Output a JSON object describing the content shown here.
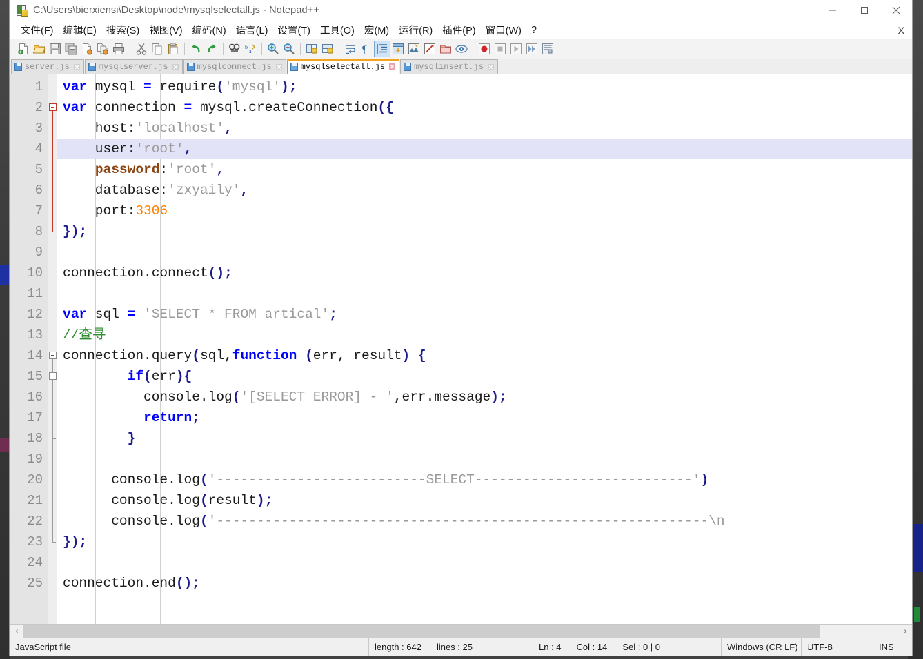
{
  "window": {
    "title": "C:\\Users\\bierxiensi\\Desktop\\node\\mysqlselectall.js - Notepad++",
    "app_icon": "notepad-plus-plus-icon",
    "controls": {
      "minimize": "–",
      "maximize": "□",
      "close": "✕"
    }
  },
  "menubar": {
    "items": [
      {
        "label": "文件(F)",
        "name": "menu-file"
      },
      {
        "label": "编辑(E)",
        "name": "menu-edit"
      },
      {
        "label": "搜索(S)",
        "name": "menu-search"
      },
      {
        "label": "视图(V)",
        "name": "menu-view"
      },
      {
        "label": "编码(N)",
        "name": "menu-encoding"
      },
      {
        "label": "语言(L)",
        "name": "menu-language"
      },
      {
        "label": "设置(T)",
        "name": "menu-settings"
      },
      {
        "label": "工具(O)",
        "name": "menu-tools"
      },
      {
        "label": "宏(M)",
        "name": "menu-macro"
      },
      {
        "label": "运行(R)",
        "name": "menu-run"
      },
      {
        "label": "插件(P)",
        "name": "menu-plugins"
      },
      {
        "label": "窗口(W)",
        "name": "menu-window"
      },
      {
        "label": "?",
        "name": "menu-help"
      }
    ],
    "close_document": "X"
  },
  "toolbar": {
    "buttons": [
      {
        "name": "new-file-icon",
        "group": 1,
        "active": false
      },
      {
        "name": "open-file-icon",
        "group": 1,
        "active": false
      },
      {
        "name": "save-icon",
        "group": 1,
        "active": false
      },
      {
        "name": "save-all-icon",
        "group": 1,
        "active": false
      },
      {
        "name": "close-file-icon",
        "group": 1,
        "active": false
      },
      {
        "name": "close-all-icon",
        "group": 1,
        "active": false
      },
      {
        "name": "print-icon",
        "group": 1,
        "active": false
      },
      {
        "name": "cut-icon",
        "group": 2,
        "active": false
      },
      {
        "name": "copy-icon",
        "group": 2,
        "active": false
      },
      {
        "name": "paste-icon",
        "group": 2,
        "active": false
      },
      {
        "name": "undo-icon",
        "group": 3,
        "active": false
      },
      {
        "name": "redo-icon",
        "group": 3,
        "active": false
      },
      {
        "name": "find-icon",
        "group": 4,
        "active": false
      },
      {
        "name": "replace-icon",
        "group": 4,
        "active": false
      },
      {
        "name": "zoom-in-icon",
        "group": 5,
        "active": false
      },
      {
        "name": "zoom-out-icon",
        "group": 5,
        "active": false
      },
      {
        "name": "sync-vertical-scroll-icon",
        "group": 6,
        "active": false
      },
      {
        "name": "sync-horizontal-scroll-icon",
        "group": 6,
        "active": false
      },
      {
        "name": "word-wrap-icon",
        "group": 7,
        "active": false
      },
      {
        "name": "show-all-chars-icon",
        "group": 7,
        "active": false
      },
      {
        "name": "indent-guide-icon",
        "group": 7,
        "active": true
      },
      {
        "name": "user-defined-dialog-icon",
        "group": 7,
        "active": false
      },
      {
        "name": "document-map-icon",
        "group": 7,
        "active": false
      },
      {
        "name": "function-list-icon",
        "group": 7,
        "active": false
      },
      {
        "name": "folder-as-workspace-icon",
        "group": 7,
        "active": false
      },
      {
        "name": "monitoring-icon",
        "group": 7,
        "active": false
      },
      {
        "name": "macro-record-icon",
        "group": 8,
        "active": false
      },
      {
        "name": "macro-stop-icon",
        "group": 8,
        "active": false
      },
      {
        "name": "macro-play-icon",
        "group": 8,
        "active": false
      },
      {
        "name": "macro-run-multiple-icon",
        "group": 8,
        "active": false
      },
      {
        "name": "macro-save-icon",
        "group": 8,
        "active": false
      }
    ]
  },
  "tabs": [
    {
      "label": "server.js",
      "active": false
    },
    {
      "label": "mysqlserver.js",
      "active": false
    },
    {
      "label": "mysqlconnect.js",
      "active": false
    },
    {
      "label": "mysqlselectall.js",
      "active": true
    },
    {
      "label": "mysqlinsert.js",
      "active": false
    }
  ],
  "editor": {
    "current_line": 4,
    "total_lines": 25,
    "line_numbers": [
      1,
      2,
      3,
      4,
      5,
      6,
      7,
      8,
      9,
      10,
      11,
      12,
      13,
      14,
      15,
      16,
      17,
      18,
      19,
      20,
      21,
      22,
      23,
      24,
      25
    ],
    "lines": [
      {
        "n": 1,
        "tokens": [
          {
            "t": "var",
            "c": "k"
          },
          {
            "t": " mysql ",
            "c": "id"
          },
          {
            "t": "=",
            "c": "op"
          },
          {
            "t": " require",
            "c": "id"
          },
          {
            "t": "(",
            "c": "p"
          },
          {
            "t": "'mysql'",
            "c": "s"
          },
          {
            "t": ")",
            "c": "p"
          },
          {
            "t": ";",
            "c": "p"
          }
        ]
      },
      {
        "n": 2,
        "tokens": [
          {
            "t": "var",
            "c": "k"
          },
          {
            "t": " connection ",
            "c": "id"
          },
          {
            "t": "=",
            "c": "op"
          },
          {
            "t": " mysql.createConnection",
            "c": "id"
          },
          {
            "t": "({",
            "c": "p"
          }
        ]
      },
      {
        "n": 3,
        "tokens": [
          {
            "t": "    host:",
            "c": "id"
          },
          {
            "t": "'localhost'",
            "c": "s"
          },
          {
            "t": ",",
            "c": "p"
          }
        ]
      },
      {
        "n": 4,
        "tokens": [
          {
            "t": "    user:",
            "c": "id"
          },
          {
            "t": "'root'",
            "c": "s"
          },
          {
            "t": ",",
            "c": "p"
          }
        ]
      },
      {
        "n": 5,
        "tokens": [
          {
            "t": "    ",
            "c": "id"
          },
          {
            "t": "password",
            "c": "kw2"
          },
          {
            "t": ":",
            "c": "id"
          },
          {
            "t": "'root'",
            "c": "s"
          },
          {
            "t": ",",
            "c": "p"
          }
        ]
      },
      {
        "n": 6,
        "tokens": [
          {
            "t": "    database:",
            "c": "id"
          },
          {
            "t": "'zxyaily'",
            "c": "s"
          },
          {
            "t": ",",
            "c": "p"
          }
        ]
      },
      {
        "n": 7,
        "tokens": [
          {
            "t": "    port:",
            "c": "id"
          },
          {
            "t": "3306",
            "c": "n"
          }
        ]
      },
      {
        "n": 8,
        "tokens": [
          {
            "t": "});",
            "c": "p"
          }
        ]
      },
      {
        "n": 9,
        "tokens": []
      },
      {
        "n": 10,
        "tokens": [
          {
            "t": "connection.connect",
            "c": "id"
          },
          {
            "t": "()",
            "c": "p"
          },
          {
            "t": ";",
            "c": "p"
          }
        ]
      },
      {
        "n": 11,
        "tokens": []
      },
      {
        "n": 12,
        "tokens": [
          {
            "t": "var",
            "c": "k"
          },
          {
            "t": " sql ",
            "c": "id"
          },
          {
            "t": "=",
            "c": "op"
          },
          {
            "t": " ",
            "c": "id"
          },
          {
            "t": "'SELECT * FROM artical'",
            "c": "s"
          },
          {
            "t": ";",
            "c": "p"
          }
        ]
      },
      {
        "n": 13,
        "tokens": [
          {
            "t": "//查寻",
            "c": "c"
          }
        ]
      },
      {
        "n": 14,
        "tokens": [
          {
            "t": "connection.query",
            "c": "id"
          },
          {
            "t": "(",
            "c": "p"
          },
          {
            "t": "sql,",
            "c": "id"
          },
          {
            "t": "function",
            "c": "k"
          },
          {
            "t": " ",
            "c": "id"
          },
          {
            "t": "(",
            "c": "p"
          },
          {
            "t": "err, result",
            "c": "id"
          },
          {
            "t": ")",
            "c": "p"
          },
          {
            "t": " ",
            "c": "id"
          },
          {
            "t": "{",
            "c": "p"
          }
        ]
      },
      {
        "n": 15,
        "tokens": [
          {
            "t": "        ",
            "c": "id"
          },
          {
            "t": "if",
            "c": "k"
          },
          {
            "t": "(",
            "c": "p"
          },
          {
            "t": "err",
            "c": "id"
          },
          {
            "t": "){",
            "c": "p"
          }
        ]
      },
      {
        "n": 16,
        "tokens": [
          {
            "t": "          console.log",
            "c": "id"
          },
          {
            "t": "(",
            "c": "p"
          },
          {
            "t": "'[SELECT ERROR] - '",
            "c": "s"
          },
          {
            "t": ",err.message",
            "c": "id"
          },
          {
            "t": ")",
            "c": "p"
          },
          {
            "t": ";",
            "c": "p"
          }
        ]
      },
      {
        "n": 17,
        "tokens": [
          {
            "t": "          ",
            "c": "id"
          },
          {
            "t": "return",
            "c": "k"
          },
          {
            "t": ";",
            "c": "p"
          }
        ]
      },
      {
        "n": 18,
        "tokens": [
          {
            "t": "        ",
            "c": "id"
          },
          {
            "t": "}",
            "c": "p"
          }
        ]
      },
      {
        "n": 19,
        "tokens": []
      },
      {
        "n": 20,
        "tokens": [
          {
            "t": "      console.log",
            "c": "id"
          },
          {
            "t": "(",
            "c": "p"
          },
          {
            "t": "'--------------------------SELECT---------------------------'",
            "c": "s"
          },
          {
            "t": ")",
            "c": "p"
          }
        ]
      },
      {
        "n": 21,
        "tokens": [
          {
            "t": "      console.log",
            "c": "id"
          },
          {
            "t": "(",
            "c": "p"
          },
          {
            "t": "result",
            "c": "id"
          },
          {
            "t": ")",
            "c": "p"
          },
          {
            "t": ";",
            "c": "p"
          }
        ]
      },
      {
        "n": 22,
        "tokens": [
          {
            "t": "      console.log",
            "c": "id"
          },
          {
            "t": "(",
            "c": "p"
          },
          {
            "t": "'-------------------------------------------------------------\\n",
            "c": "s"
          }
        ]
      },
      {
        "n": 23,
        "tokens": [
          {
            "t": "});",
            "c": "p"
          }
        ]
      },
      {
        "n": 24,
        "tokens": []
      },
      {
        "n": 25,
        "tokens": [
          {
            "t": "connection.end",
            "c": "id"
          },
          {
            "t": "()",
            "c": "p"
          },
          {
            "t": ";",
            "c": "p"
          }
        ]
      }
    ],
    "folds": [
      {
        "line": 2,
        "type": "open",
        "color": "red"
      },
      {
        "line": 8,
        "type": "end",
        "color": "red"
      },
      {
        "line": 14,
        "type": "open",
        "color": "grey"
      },
      {
        "line": 15,
        "type": "open",
        "color": "grey"
      },
      {
        "line": 18,
        "type": "tick",
        "color": "grey"
      },
      {
        "line": 23,
        "type": "end",
        "color": "grey"
      }
    ]
  },
  "scrollbar": {
    "left_arrow": "‹",
    "right_arrow": "›",
    "thumb_percent": 91
  },
  "statusbar": {
    "file_type": "JavaScript file",
    "length_label": "length : 642",
    "lines_label": "lines : 25",
    "ln": "Ln : 4",
    "col": "Col : 14",
    "sel": "Sel : 0 | 0",
    "eol": "Windows (CR LF)",
    "encoding": "UTF-8",
    "insert_mode": "INS"
  },
  "colors": {
    "accent_tab": "#f5a31e",
    "keyword": "#0000ff",
    "string": "#9a9a9a",
    "number": "#ff8000",
    "comment": "#2e8b2e",
    "bracket": "#1a1a8c",
    "secondary_keyword": "#8b4513",
    "current_line_bg": "#e2e3f7"
  }
}
